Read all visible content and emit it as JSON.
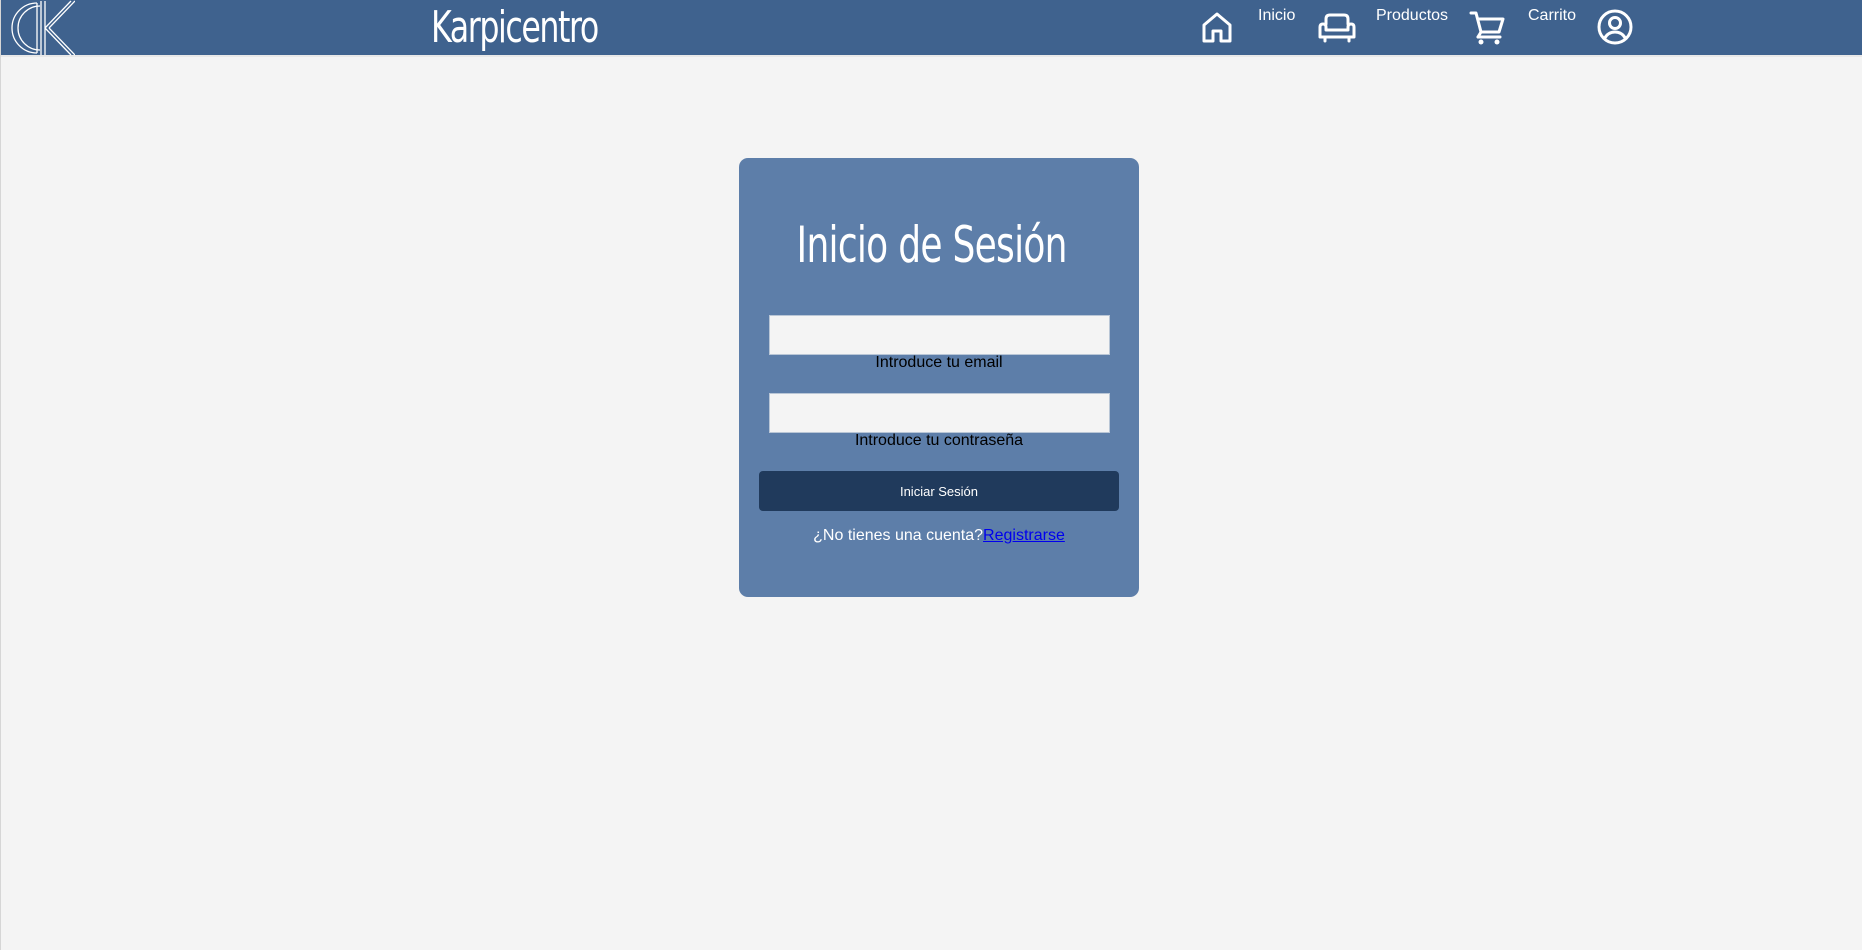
{
  "header": {
    "brand": "Karpicentro",
    "nav": {
      "home": {
        "label": "Inicio",
        "icon": "home-icon"
      },
      "products": {
        "label": "Productos",
        "icon": "sofa-icon"
      },
      "cart": {
        "label": "Carrito",
        "icon": "cart-icon"
      },
      "account": {
        "icon": "user-circle-icon"
      }
    }
  },
  "login": {
    "title": "Inicio de Sesión",
    "email_label": "Introduce tu email",
    "email_value": "",
    "password_label": "Introduce tu contraseña",
    "password_value": "",
    "submit_label": "Iniciar Sesión",
    "register_prompt": "¿No tienes una cuenta?",
    "register_link": "Registrarse"
  },
  "colors": {
    "header_bg": "#3f628e",
    "card_bg": "#5d7ea9",
    "button_bg": "#203a5c",
    "page_bg": "#f4f4f4",
    "link": "#0000ee"
  }
}
